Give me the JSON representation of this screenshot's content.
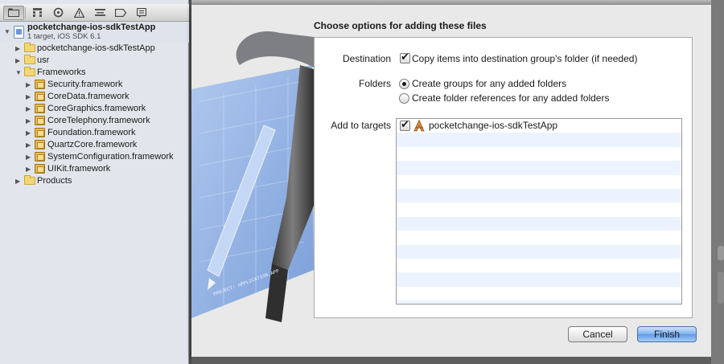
{
  "navigator": {
    "tabs": [
      "folder-icon",
      "hierarchy-icon",
      "search-icon",
      "warning-icon",
      "list-icon",
      "breakpoint-icon",
      "log-icon"
    ],
    "project": {
      "name": "pocketchange-ios-sdkTestApp",
      "subtitle": "1 target, iOS SDK 6.1"
    },
    "items": [
      {
        "label": "pocketchange-ios-sdkTestApp",
        "kind": "folder",
        "depth": 1,
        "expanded": false
      },
      {
        "label": "usr",
        "kind": "folder",
        "depth": 1,
        "expanded": false
      },
      {
        "label": "Frameworks",
        "kind": "folder",
        "depth": 1,
        "expanded": true
      },
      {
        "label": "Security.framework",
        "kind": "framework",
        "depth": 2,
        "expanded": false
      },
      {
        "label": "CoreData.framework",
        "kind": "framework",
        "depth": 2,
        "expanded": false
      },
      {
        "label": "CoreGraphics.framework",
        "kind": "framework",
        "depth": 2,
        "expanded": false
      },
      {
        "label": "CoreTelephony.framework",
        "kind": "framework",
        "depth": 2,
        "expanded": false
      },
      {
        "label": "Foundation.framework",
        "kind": "framework",
        "depth": 2,
        "expanded": false
      },
      {
        "label": "QuartzCore.framework",
        "kind": "framework",
        "depth": 2,
        "expanded": false
      },
      {
        "label": "SystemConfiguration.framework",
        "kind": "framework",
        "depth": 2,
        "expanded": false
      },
      {
        "label": "UIKit.framework",
        "kind": "framework",
        "depth": 2,
        "expanded": false
      },
      {
        "label": "Products",
        "kind": "folder",
        "depth": 1,
        "expanded": false
      }
    ]
  },
  "dialog": {
    "title": "Choose options for adding these files",
    "destination": {
      "label": "Destination",
      "checkbox_label": "Copy items into destination group's folder (if needed)",
      "checked": true
    },
    "folders": {
      "label": "Folders",
      "options": [
        {
          "label": "Create groups for any added folders",
          "selected": true
        },
        {
          "label": "Create folder references for any added folders",
          "selected": false
        }
      ]
    },
    "targets": {
      "label": "Add to targets",
      "items": [
        {
          "name": "pocketchange-ios-sdkTestApp",
          "checked": true
        }
      ]
    },
    "buttons": {
      "cancel": "Cancel",
      "finish": "Finish"
    },
    "artwork_text": "PROJECT: APPLICATION.APP"
  }
}
